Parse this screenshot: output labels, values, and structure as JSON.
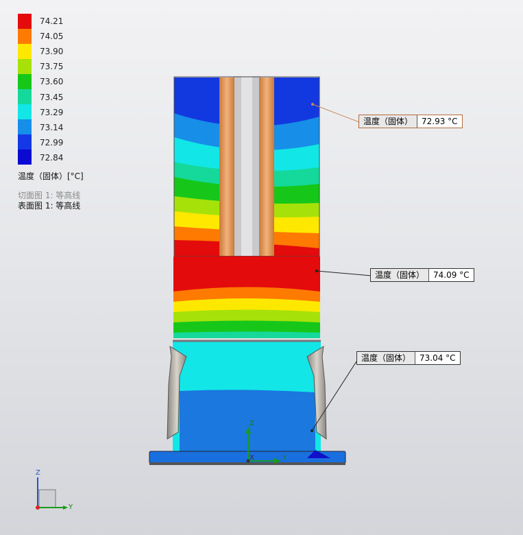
{
  "legend": {
    "ticks": [
      "74.21",
      "74.05",
      "73.90",
      "73.75",
      "73.60",
      "73.45",
      "73.29",
      "73.14",
      "72.99",
      "72.84"
    ],
    "colors": [
      "#e30b0b",
      "#ff7a00",
      "#ffe800",
      "#a6e20a",
      "#16c71a",
      "#14d99a",
      "#13e6e6",
      "#178ee8",
      "#1438e6",
      "#0a0ad1"
    ],
    "title": "温度（固体）[°C]"
  },
  "info": {
    "section_plot": "切面图 1: 等高线",
    "surface_plot": "表面图 1: 等高线"
  },
  "probes": [
    {
      "label": "温度（固体）",
      "value": "72.93 °C"
    },
    {
      "label": "温度（固体）",
      "value": "74.09 °C"
    },
    {
      "label": "温度（固体）",
      "value": "73.04 °C"
    }
  ],
  "triad": {
    "z": "Z",
    "x": "X",
    "y": "Y"
  },
  "main_triad": {
    "z": "Z",
    "x": "X",
    "y": "Y"
  }
}
